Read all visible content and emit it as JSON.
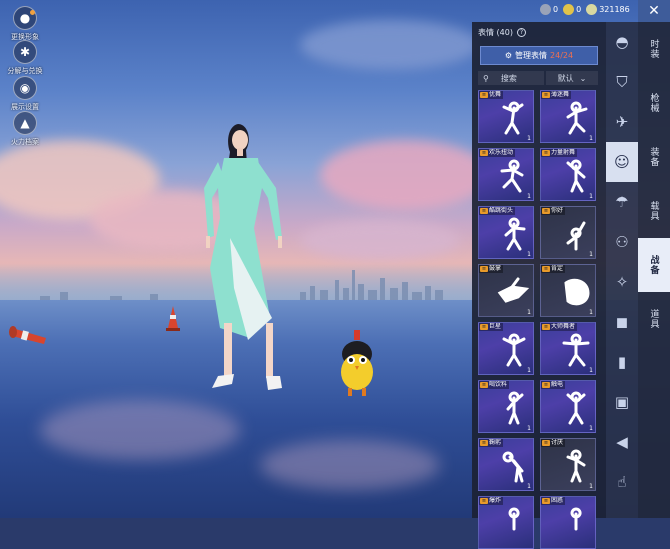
{
  "left_menu": [
    {
      "name": "change-appearance",
      "label": "更换形象",
      "icon": "person-icon"
    },
    {
      "name": "disassemble-craft",
      "label": "分解与兑换",
      "icon": "puzzle-icon"
    },
    {
      "name": "display-settings",
      "label": "展示设置",
      "icon": "eye-icon"
    },
    {
      "name": "firepower-archive",
      "label": "火力档案",
      "icon": "flame-icon"
    }
  ],
  "currency": [
    {
      "name": "currency-a",
      "value": "0",
      "color": "#9aa3b8"
    },
    {
      "name": "currency-b",
      "value": "0",
      "color": "#e2c34a"
    },
    {
      "name": "currency-c",
      "value": "321186",
      "color": "#d8d8a0"
    }
  ],
  "panel": {
    "title": "表情 (40)",
    "help": "?",
    "manage_label": "管理表情",
    "manage_count": "24/24",
    "search_placeholder": "搜索",
    "sort_label": "默认"
  },
  "emotes": [
    {
      "label": "优舞",
      "count": "1",
      "tag": true
    },
    {
      "label": "薄迷舞",
      "count": "1",
      "tag": true
    },
    {
      "label": "欢乐扭动",
      "count": "1",
      "tag": true
    },
    {
      "label": "力量射舞",
      "count": "1",
      "tag": true
    },
    {
      "label": "酷跳街头",
      "count": "1",
      "tag": true
    },
    {
      "label": "你好",
      "count": "1",
      "tag": true
    },
    {
      "label": "鼓掌",
      "count": "1",
      "tag": true
    },
    {
      "label": "肯定",
      "count": "1",
      "tag": true
    },
    {
      "label": "巨星",
      "count": "1",
      "tag": true
    },
    {
      "label": "大师舞者",
      "count": "1",
      "tag": true
    },
    {
      "label": "喝饮料",
      "count": "1",
      "tag": true
    },
    {
      "label": "触电",
      "count": "1",
      "tag": true
    },
    {
      "label": "鞠躬",
      "count": "1",
      "tag": true
    },
    {
      "label": "讨厌",
      "count": "1",
      "tag": true
    },
    {
      "label": "爆炸",
      "count": "",
      "tag": true
    },
    {
      "label": "困惑",
      "count": "",
      "tag": true
    }
  ],
  "categories": [
    "hat-icon",
    "shirt-icon",
    "plane-icon",
    "smiley-icon",
    "parachute-icon",
    "robot-icon",
    "wand-icon",
    "badge-icon",
    "extinguisher-icon",
    "picture-icon",
    "speaker-icon",
    "touch-icon"
  ],
  "tabs": [
    "时装",
    "枪械",
    "装备",
    "载具",
    "战备",
    "道具"
  ],
  "active_tab": "战备",
  "close_icon": "close-icon"
}
